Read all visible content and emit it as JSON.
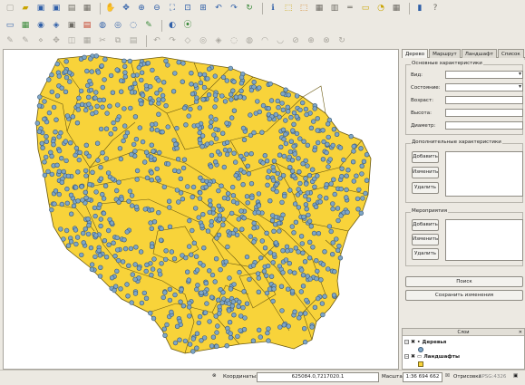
{
  "toolbar1": [
    {
      "icon": "new-project-icon",
      "glyph": "▢",
      "color": "dim"
    },
    {
      "icon": "open-folder-icon",
      "glyph": "▰",
      "color": "yellow"
    },
    {
      "icon": "save-icon",
      "glyph": "▣",
      "color": "blue"
    },
    {
      "icon": "save-as-icon",
      "glyph": "▣",
      "color": "blue"
    },
    {
      "icon": "print-composer-icon",
      "glyph": "▤",
      "color": "gray"
    },
    {
      "icon": "composer-manager-icon",
      "glyph": "▦",
      "color": "gray"
    },
    {
      "icon": "sep"
    },
    {
      "icon": "pan-hand-icon",
      "glyph": "✋",
      "color": "gray"
    },
    {
      "icon": "pan-to-selection-icon",
      "glyph": "✥",
      "color": "blue"
    },
    {
      "icon": "zoom-in-icon",
      "glyph": "⊕",
      "color": "blue"
    },
    {
      "icon": "zoom-out-icon",
      "glyph": "⊖",
      "color": "blue"
    },
    {
      "icon": "zoom-full-icon",
      "glyph": "⛶",
      "color": "blue"
    },
    {
      "icon": "zoom-layer-icon",
      "glyph": "⊡",
      "color": "blue"
    },
    {
      "icon": "zoom-selection-icon",
      "glyph": "⊞",
      "color": "blue"
    },
    {
      "icon": "zoom-last-icon",
      "glyph": "↶",
      "color": "blue"
    },
    {
      "icon": "zoom-next-icon",
      "glyph": "↷",
      "color": "blue"
    },
    {
      "icon": "refresh-icon",
      "glyph": "↻",
      "color": "green"
    },
    {
      "icon": "sep"
    },
    {
      "icon": "identify-icon",
      "glyph": "ℹ",
      "color": "blue"
    },
    {
      "icon": "select-features-icon",
      "glyph": "⬚",
      "color": "yellow"
    },
    {
      "icon": "deselect-icon",
      "glyph": "⬚",
      "color": "orange"
    },
    {
      "icon": "attribute-table-icon",
      "glyph": "▦",
      "color": "gray"
    },
    {
      "icon": "field-calculator-icon",
      "glyph": "▥",
      "color": "gray"
    },
    {
      "icon": "measure-icon",
      "glyph": "═",
      "color": "gray"
    },
    {
      "icon": "annotation-icon",
      "glyph": "▭",
      "color": "yellow"
    },
    {
      "icon": "tips-icon",
      "glyph": "◔",
      "color": "yellow"
    },
    {
      "icon": "bookmarks-icon",
      "glyph": "▦",
      "color": "gray"
    },
    {
      "icon": "sep"
    },
    {
      "icon": "python-console-icon",
      "glyph": "▮",
      "color": "blue"
    },
    {
      "icon": "help-icon",
      "glyph": "?",
      "color": "gray"
    }
  ],
  "toolbar2": [
    {
      "icon": "add-vector-layer-icon",
      "glyph": "▭",
      "color": "blue"
    },
    {
      "icon": "add-raster-layer-icon",
      "glyph": "▦",
      "color": "green"
    },
    {
      "icon": "add-postgis-layer-icon",
      "glyph": "◉",
      "color": "blue"
    },
    {
      "icon": "add-spatialite-layer-icon",
      "glyph": "◈",
      "color": "blue"
    },
    {
      "icon": "add-mssql-layer-icon",
      "glyph": "▣",
      "color": "gray"
    },
    {
      "icon": "add-oracle-layer-icon",
      "glyph": "▤",
      "color": "red"
    },
    {
      "icon": "add-wms-layer-icon",
      "glyph": "◍",
      "color": "blue"
    },
    {
      "icon": "add-wcs-layer-icon",
      "glyph": "◎",
      "color": "blue"
    },
    {
      "icon": "add-wfs-layer-icon",
      "glyph": "◌",
      "color": "blue"
    },
    {
      "icon": "add-delimited-text-icon",
      "glyph": "✎",
      "color": "green"
    },
    {
      "icon": "sep"
    },
    {
      "icon": "globe-icon",
      "glyph": "◐",
      "color": "blue"
    },
    {
      "icon": "gps-icon",
      "glyph": "⦿",
      "color": "green"
    }
  ],
  "toolbar3": [
    {
      "icon": "toggle-editing-icon",
      "glyph": "✎",
      "color": "dim"
    },
    {
      "icon": "save-edits-icon",
      "glyph": "✎",
      "color": "dim"
    },
    {
      "icon": "add-feature-icon",
      "glyph": "⋄",
      "color": "dim"
    },
    {
      "icon": "move-feature-icon",
      "glyph": "✥",
      "color": "dim"
    },
    {
      "icon": "node-tool-icon",
      "glyph": "◫",
      "color": "dim"
    },
    {
      "icon": "delete-selected-icon",
      "glyph": "▦",
      "color": "dim"
    },
    {
      "icon": "cut-features-icon",
      "glyph": "✂",
      "color": "dim"
    },
    {
      "icon": "copy-features-icon",
      "glyph": "⧉",
      "color": "dim"
    },
    {
      "icon": "paste-features-icon",
      "glyph": "▤",
      "color": "dim"
    },
    {
      "icon": "sep"
    },
    {
      "icon": "undo-icon",
      "glyph": "↶",
      "color": "dim"
    },
    {
      "icon": "redo-icon",
      "glyph": "↷",
      "color": "dim"
    },
    {
      "icon": "simplify-icon",
      "glyph": "◇",
      "color": "dim"
    },
    {
      "icon": "add-ring-icon",
      "glyph": "◎",
      "color": "dim"
    },
    {
      "icon": "add-part-icon",
      "glyph": "◈",
      "color": "dim"
    },
    {
      "icon": "delete-ring-icon",
      "glyph": "◌",
      "color": "dim"
    },
    {
      "icon": "delete-part-icon",
      "glyph": "◍",
      "color": "dim"
    },
    {
      "icon": "reshape-icon",
      "glyph": "◠",
      "color": "dim"
    },
    {
      "icon": "offset-curve-icon",
      "glyph": "◡",
      "color": "dim"
    },
    {
      "icon": "split-features-icon",
      "glyph": "⊘",
      "color": "dim"
    },
    {
      "icon": "merge-features-icon",
      "glyph": "⊕",
      "color": "dim"
    },
    {
      "icon": "merge-attributes-icon",
      "glyph": "⊗",
      "color": "dim"
    },
    {
      "icon": "rotate-symbols-icon",
      "glyph": "↻",
      "color": "dim"
    }
  ],
  "panel": {
    "tabs": [
      "Дерево",
      "Маршрут",
      "Ландшафт",
      "Список"
    ],
    "tab_arrows": "◂ ▸",
    "basic": {
      "title": "Основные характеристики",
      "fields": [
        "Вид:",
        "Состояние:",
        "Возраст:",
        "Высота:",
        "Диаметр:"
      ]
    },
    "extra": {
      "title": "Дополнительные характеристики",
      "buttons": [
        "Добавить",
        "Изменить",
        "Удалить"
      ]
    },
    "events": {
      "title": "Мероприятия",
      "buttons": [
        "Добавить",
        "Изменить",
        "Удалить"
      ]
    },
    "search": "Поиск",
    "save": "Сохранить изменения"
  },
  "layers": {
    "title": "Слои",
    "items": [
      "Деревья",
      "Ландшафты"
    ]
  },
  "status": {
    "coords_label": "Координаты:",
    "coords_value": "625084.0,7217020.1",
    "scale_label": "Масштаб",
    "scale_value": "1:36 694 662",
    "render_label": "Отрисовка",
    "crs": "EPSG:4326"
  },
  "colors": {
    "polygon_fill": "#f8d33a",
    "polygon_stroke": "#6b5a12",
    "point_fill": "#7ea6c6",
    "point_stroke": "#3c5a78"
  }
}
